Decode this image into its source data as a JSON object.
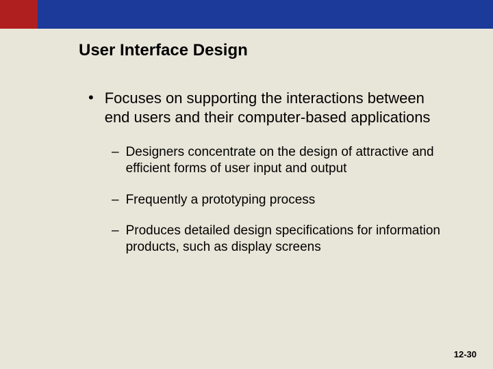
{
  "title": "User Interface Design",
  "main_bullet": "Focuses on supporting the interactions between end users and their computer-based applications",
  "sub_bullets": [
    "Designers concentrate on the design of attractive and efficient forms of user input and output",
    "Frequently a prototyping process",
    "Produces detailed design specifications for information products, such as display screens"
  ],
  "page_number": "12-30"
}
